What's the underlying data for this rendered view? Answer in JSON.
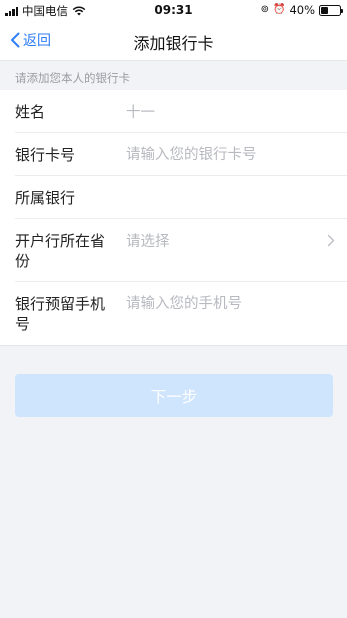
{
  "status_bar": {
    "carrier": "中国电信",
    "time": "09:31",
    "battery_percent": "40%",
    "battery_level": 0.4
  },
  "nav": {
    "back_label": "返回",
    "title": "添加银行卡"
  },
  "hint": "请添加您本人的银行卡",
  "form": {
    "name_label": "姓名",
    "name_value": "十一",
    "card_label": "银行卡号",
    "card_placeholder": "请输入您的银行卡号",
    "bank_label": "所属银行",
    "province_label": "开户行所在省份",
    "province_placeholder": "请选择",
    "phone_label": "银行预留手机号",
    "phone_placeholder": "请输入您的手机号"
  },
  "next_button_label": "下一步",
  "colors": {
    "accent": "#2f7df6",
    "button_disabled": "#cfe5fd",
    "background": "#f2f3f7"
  }
}
